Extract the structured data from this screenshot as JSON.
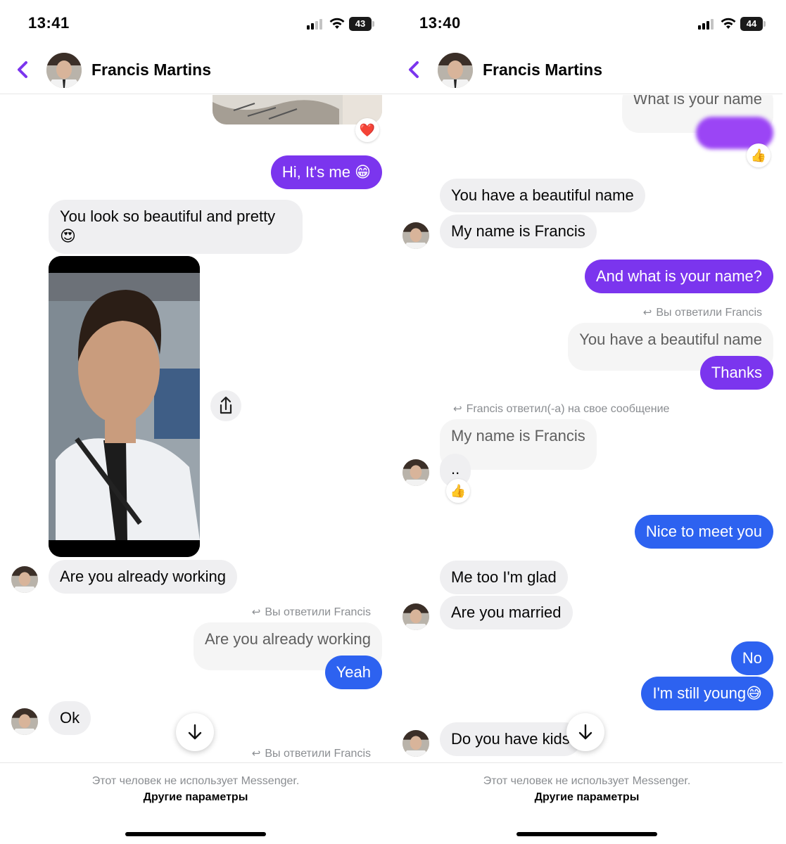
{
  "left": {
    "time": "13:41",
    "battery": "43",
    "contact_name": "Francis Martins",
    "messages": {
      "m1": "Hi, It's me 😁",
      "m2": "You look so beautiful and pretty",
      "m2_emoji": "😍",
      "m3": "Are you already working",
      "reply1_label": "Вы ответили Francis",
      "reply1_quote": "Are you already working",
      "m4": "Yeah",
      "m5": "Ok",
      "reply2_label": "Вы ответили Francis"
    },
    "reactions": {
      "image": "❤️"
    },
    "footer": {
      "notice": "Этот человек не использует Messenger.",
      "link": "Другие параметры"
    }
  },
  "right": {
    "time": "13:40",
    "battery": "44",
    "contact_name": "Francis Martins",
    "messages": {
      "quote_top": "What is your name",
      "m1": "You have a beautiful name",
      "m2": "My name is Francis",
      "m3": "And what is your name?",
      "reply1_label": "Вы ответили Francis",
      "reply1_quote": "You have a beautiful name",
      "m4": "Thanks",
      "reply2_label": "Francis ответил(-а) на свое сообщение",
      "reply2_quote": "My name is Francis",
      "m5": "..",
      "m6": "Nice to meet you",
      "m7": "Me too I'm glad",
      "m8": "Are you married",
      "m9": "No",
      "m10": "I'm still young😅",
      "m11": "Do you have kids"
    },
    "reactions": {
      "blurred": "👍",
      "dots": "👍"
    },
    "footer": {
      "notice": "Этот человек не использует Messenger.",
      "link": "Другие параметры"
    }
  },
  "theme": {
    "accent": "#7b35ee",
    "blue": "#2d62f0",
    "incoming": "#efeff1"
  },
  "icons": [
    "back-chevron-icon",
    "signal-icon",
    "wifi-icon",
    "battery-icon",
    "share-icon",
    "arrow-down-icon",
    "reply-arrow-icon"
  ]
}
